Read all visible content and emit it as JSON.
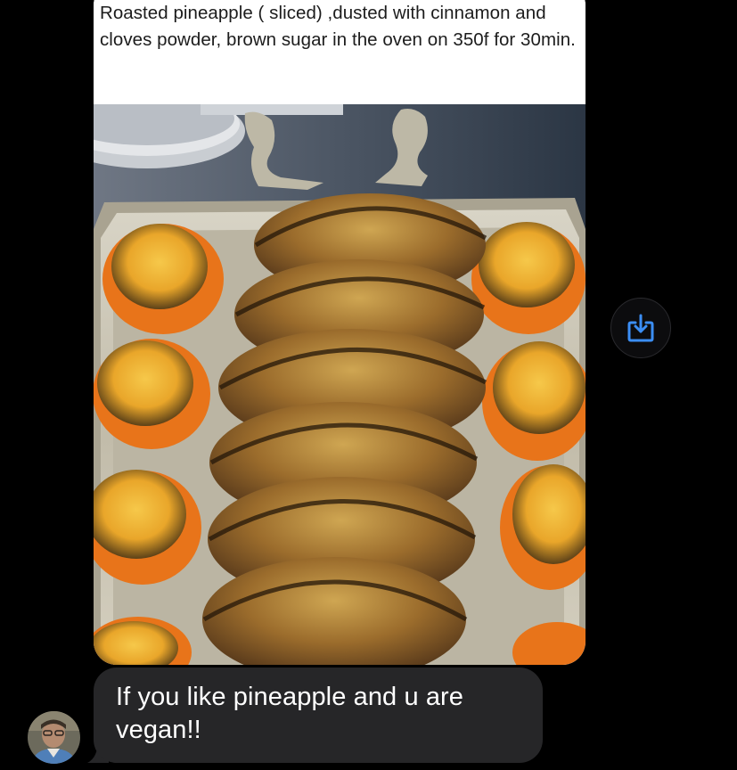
{
  "conversation": {
    "media_message": {
      "caption": "Roasted pineapple ( sliced) ,dusted with cinnamon and cloves powder, brown sugar in the oven on 350f for 30min.",
      "photo": "roasted-pineapple-platter"
    },
    "share_button": {
      "icon": "share-download-icon",
      "color": "#3b8ef5"
    },
    "text_message": {
      "text": "If you like pineapple and u are vegan!!",
      "bubble_color": "#262628"
    },
    "sender": {
      "avatar": "sender-avatar"
    }
  },
  "colors": {
    "background": "#000000",
    "caption_background": "#ffffff",
    "accent": "#3b8ef5"
  }
}
